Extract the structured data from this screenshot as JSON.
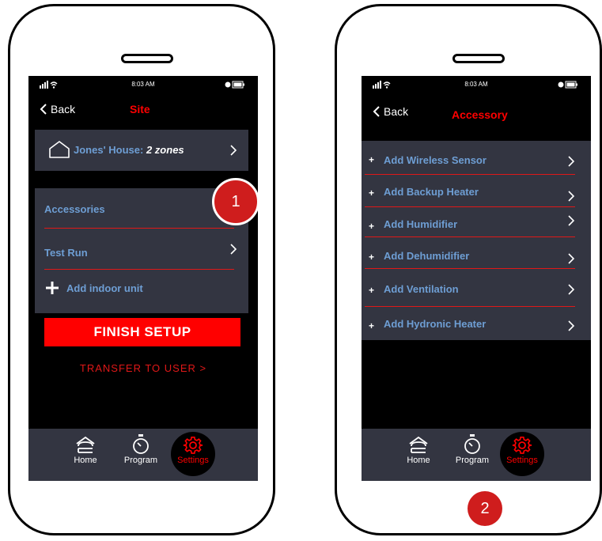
{
  "status": {
    "time": "8:03 AM"
  },
  "left": {
    "back_label": "Back",
    "title": "Site",
    "house": {
      "name": "Jones' House:",
      "zones": "2 zones"
    },
    "menu": {
      "accessories": "Accessories",
      "test_run": "Test Run",
      "add_indoor": "Add indoor unit"
    },
    "finish_label": "FINISH SETUP",
    "transfer_label": "TRANSFER TO USER  >",
    "callout": "1"
  },
  "right": {
    "back_label": "Back",
    "title": "Accessory",
    "items": [
      {
        "label": "Add Wireless Sensor"
      },
      {
        "label": "Add Backup Heater"
      },
      {
        "label": "Add Humidifier"
      },
      {
        "label": "Add Dehumidifier"
      },
      {
        "label": "Add Ventilation"
      },
      {
        "label": "Add Hydronic Heater"
      }
    ],
    "callout": "2"
  },
  "tabs": {
    "home": "Home",
    "program": "Program",
    "settings": "Settings"
  },
  "colors": {
    "accent": "#ff0000",
    "label_blue": "#6e9ed4",
    "panel": "#333541",
    "divider": "#e01818"
  }
}
